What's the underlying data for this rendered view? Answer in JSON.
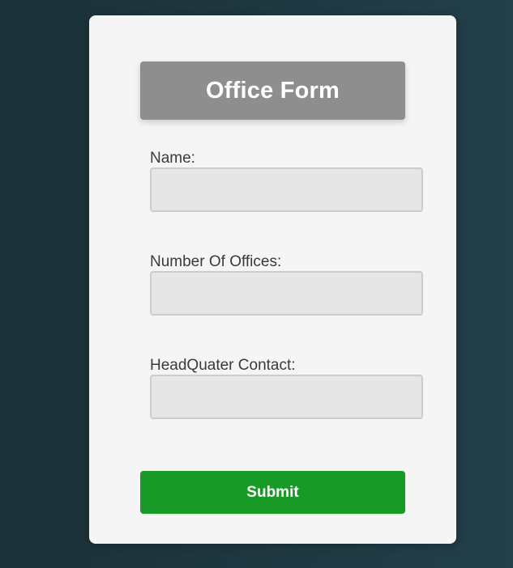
{
  "form": {
    "title": "Office Form",
    "fields": [
      {
        "label": "Name:",
        "value": "",
        "placeholder": ""
      },
      {
        "label": "Number Of Offices:",
        "value": "",
        "placeholder": ""
      },
      {
        "label": "HeadQuater Contact:",
        "value": "",
        "placeholder": ""
      }
    ],
    "submit_label": "Submit"
  },
  "colors": {
    "background_left": "#1b3037",
    "background_right": "#223f4a",
    "card": "#f5f5f5",
    "title_box": "#8e8e8e",
    "input_fill": "#e6e6e6",
    "submit_button": "#189a26"
  }
}
